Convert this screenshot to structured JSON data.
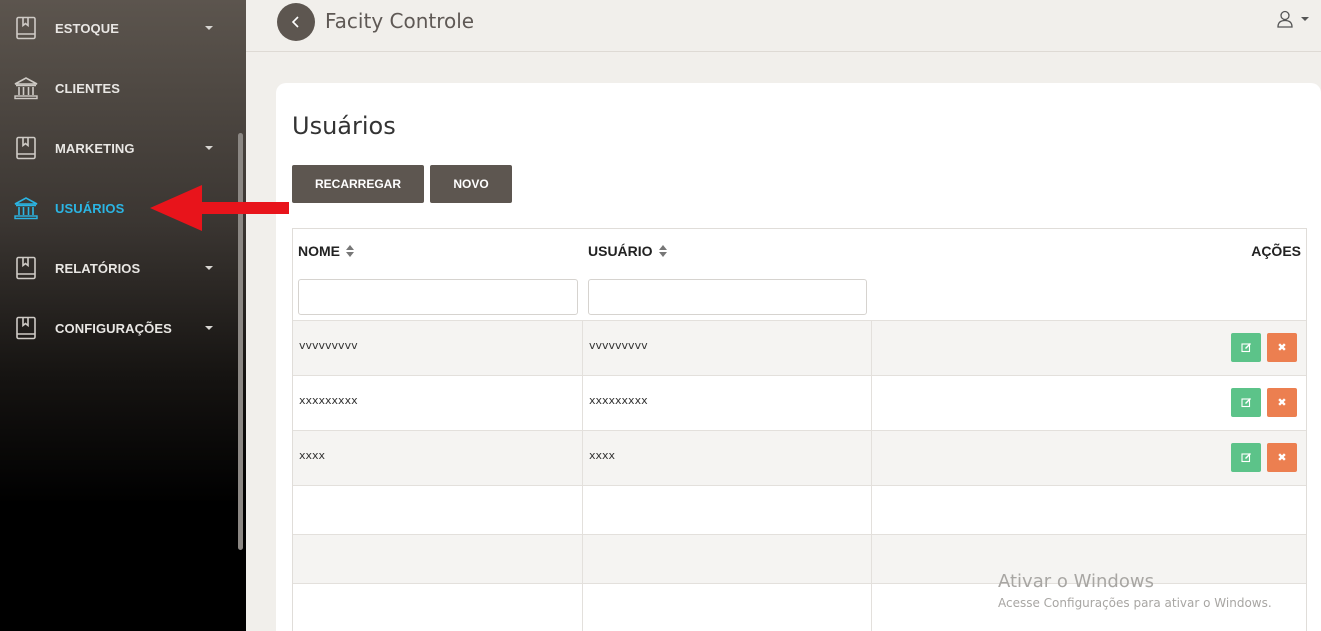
{
  "sidebar": {
    "items": [
      {
        "label": "ESTOQUE",
        "icon": "book-icon",
        "has_caret": true
      },
      {
        "label": "CLIENTES",
        "icon": "bank-icon",
        "has_caret": false
      },
      {
        "label": "MARKETING",
        "icon": "book-icon",
        "has_caret": true
      },
      {
        "label": "USUÁRIOS",
        "icon": "bank-icon",
        "has_caret": false,
        "active": true
      },
      {
        "label": "RELATÓRIOS",
        "icon": "book-icon",
        "has_caret": true
      },
      {
        "label": "CONFIGURAÇÕES",
        "icon": "book-icon",
        "has_caret": true
      }
    ]
  },
  "header": {
    "title": "Facity Controle"
  },
  "main": {
    "title": "Usuários",
    "buttons": {
      "reload": "RECARREGAR",
      "new": "NOVO"
    },
    "table": {
      "columns": [
        "NOME",
        "USUÁRIO",
        "AÇÕES"
      ],
      "rows": [
        {
          "nome": "vvvvvvvvv",
          "usuario": "vvvvvvvvv"
        },
        {
          "nome": "xxxxxxxxx",
          "usuario": "xxxxxxxxx"
        },
        {
          "nome": "xxxx",
          "usuario": "xxxx"
        }
      ]
    }
  },
  "watermark": {
    "line1": "Ativar o Windows",
    "line2": "Acesse Configurações para ativar o Windows."
  },
  "colors": {
    "accent_active": "#2bb5e4",
    "button_bg": "#5d5650",
    "edit_button": "#5cc389",
    "delete_button": "#ec7f50",
    "annotation_arrow": "#e8141b"
  }
}
